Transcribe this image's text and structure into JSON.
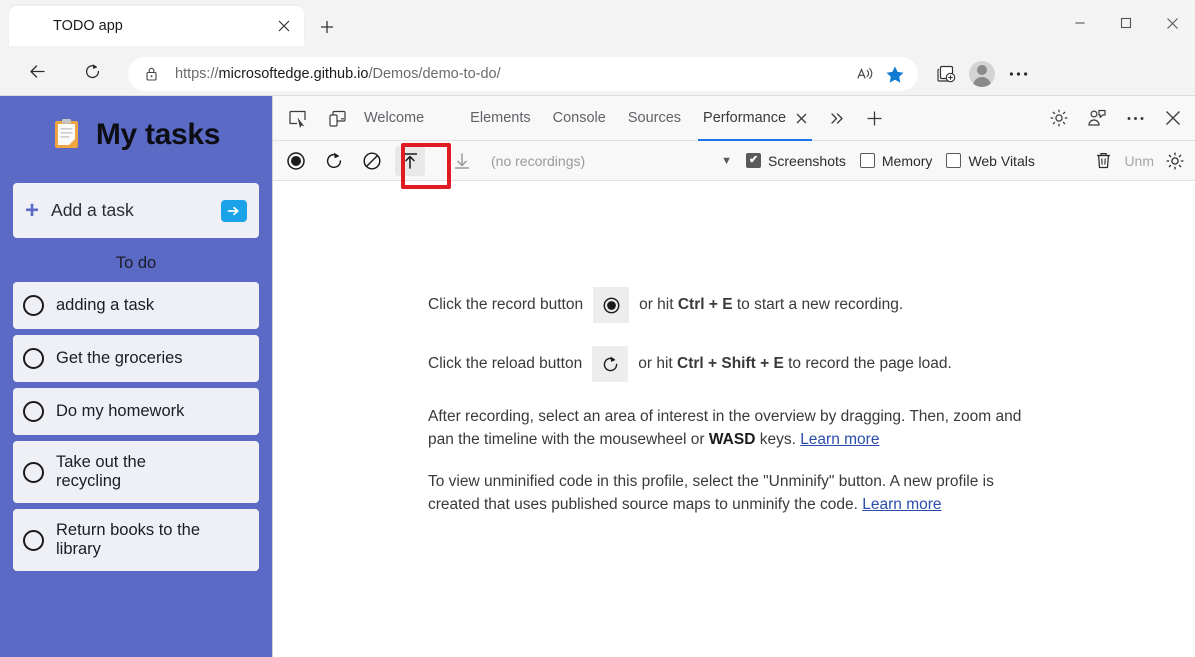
{
  "browser": {
    "tab": {
      "favicon": "clipboard-icon",
      "title": "TODO app",
      "close_label": "✕"
    },
    "new_tab_label": "+",
    "window_controls": {
      "minimize": "—",
      "maximize": "□",
      "close": "✕"
    },
    "nav": {
      "back": "back-arrow-icon",
      "refresh": "refresh-icon"
    },
    "url": {
      "lock": "lock-icon",
      "scheme": "https://",
      "host": "microsoftedge.github.io",
      "path": "/Demos/demo-to-do/",
      "read_aloud": "read-aloud-icon",
      "favorite": "star-filled-icon"
    },
    "right_icons": {
      "collections": "collections-icon",
      "profile": "profile-avatar-icon",
      "settings_more": "…"
    }
  },
  "page": {
    "heading": {
      "icon": "📋",
      "title": "My tasks"
    },
    "add_task": {
      "plus": "+",
      "placeholder": "Add a task",
      "submit_label": "➔"
    },
    "section_label": "To do",
    "tasks": [
      {
        "label": "adding a task"
      },
      {
        "label": "Get the groceries"
      },
      {
        "label": "Do my homework"
      },
      {
        "label": "Take out the recycling"
      },
      {
        "label": "Return books to the library"
      }
    ]
  },
  "devtools": {
    "left_icons": [
      {
        "name": "inspect-element-icon"
      },
      {
        "name": "device-emulation-icon"
      }
    ],
    "tabs": [
      {
        "label": "Welcome",
        "active": false
      },
      {
        "label": "Elements",
        "active": false
      },
      {
        "label": "Console",
        "active": false
      },
      {
        "label": "Sources",
        "active": false
      },
      {
        "label": "Performance",
        "active": true,
        "close": "✕"
      }
    ],
    "more_tabs": "»",
    "add_panel": "+",
    "right_icons": [
      {
        "name": "settings-gear-icon"
      },
      {
        "name": "feedback-icon"
      },
      {
        "name": "customize-more-icon",
        "glyph": "…"
      },
      {
        "name": "close-devtools-icon",
        "glyph": "✕"
      }
    ],
    "toolbar": {
      "record_icon": "record-circle-icon",
      "reload_record_icon": "reload-record-icon",
      "clear_icon": "clear-prohibited-icon",
      "upload_icon": "upload-profile-icon",
      "download_icon": "download-profile-icon",
      "recordings_text": "(no recordings)",
      "caret": "▼",
      "checkboxes": [
        {
          "label": "Screenshots",
          "checked": true,
          "tick": "✔"
        },
        {
          "label": "Memory",
          "checked": false,
          "tick": ""
        },
        {
          "label": "Web Vitals",
          "checked": false,
          "tick": ""
        }
      ],
      "trash_icon": "trash-icon",
      "unminify_label": "Unm",
      "capture_settings_icon": "capture-settings-gear-icon"
    },
    "content": {
      "hint1": {
        "before": "Click the record button",
        "button_icon": "record-circle-icon",
        "after_plain1": "or hit ",
        "shortcut": "Ctrl + E",
        "after_plain2": " to start a new recording."
      },
      "hint2": {
        "before": "Click the reload button",
        "button_icon": "reload-record-icon",
        "after_plain1": "or hit ",
        "shortcut": "Ctrl + Shift + E",
        "after_plain2": " to record the page load."
      },
      "para1_part1": "After recording, select an area of interest in the overview by dragging. Then, zoom and pan the timeline with the mousewheel or ",
      "para1_bold": "WASD",
      "para1_part2": " keys. ",
      "para1_link": "Learn more",
      "para2_part1": "To view unminified code in this profile, select the \"Unminify\" button. A new profile is created that uses published source maps to unminify the code. ",
      "para2_link": "Learn more"
    }
  }
}
